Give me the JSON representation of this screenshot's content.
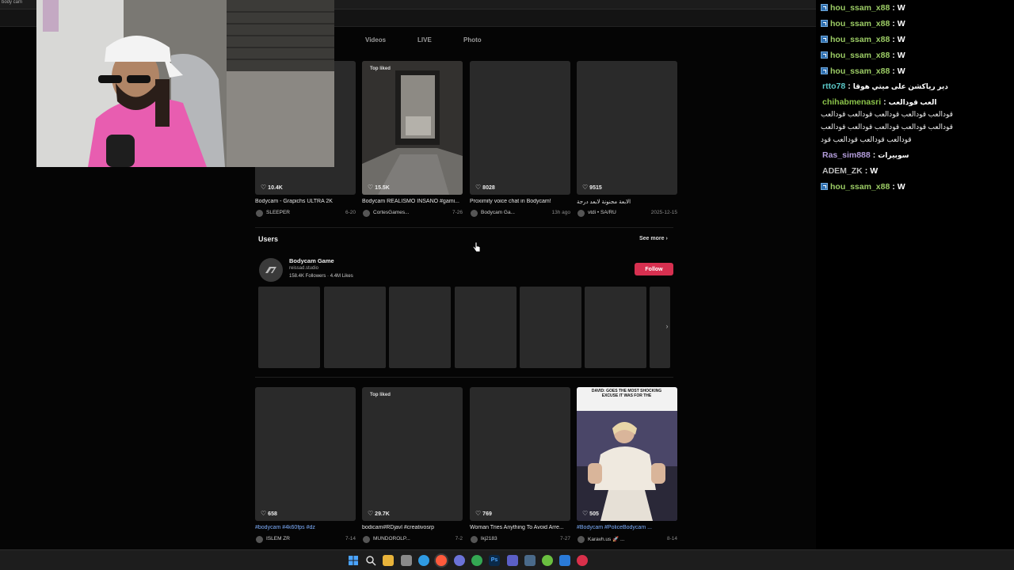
{
  "window": {
    "tab_title": "body cam"
  },
  "search": {
    "tabs": [
      "Videos",
      "LIVE",
      "Photo"
    ]
  },
  "top_videos": [
    {
      "likes": "10.4K",
      "caption": "Bodycam - Grapichs ULTRA 2K",
      "author": "SLEEPER",
      "date": "6-20",
      "badge": ""
    },
    {
      "likes": "15.5K",
      "caption": "Bodycam REALISMO INSANO #gami...",
      "author": "CortesGames...",
      "date": "7-26",
      "badge": "Top liked"
    },
    {
      "likes": "8028",
      "caption": "Proximity voice chat in Bodycam!",
      "author": "Bodycam Ga...",
      "date": "13h ago",
      "badge": ""
    },
    {
      "likes": "9515",
      "caption": "الابعة مجنونة لابعد درجة",
      "author": "vtdi • SA/RU",
      "date": "2025-12-15",
      "badge": ""
    }
  ],
  "users_section": {
    "title": "Users",
    "see_more": "See more",
    "user": {
      "name": "Bodycam Game",
      "handle": "reissad.studio",
      "followers": "158.4K Followers",
      "likes": "4.4M Likes",
      "follow_label": "Follow"
    },
    "thumb_count": 7
  },
  "bottom_videos": [
    {
      "likes": "658",
      "caption": "#bodycam #4k60fps #dz",
      "author": "ISLEM ZR",
      "date": "7-14",
      "badge": "",
      "tag": true
    },
    {
      "likes": "29.7K",
      "caption": "bodicam#RDjavl #creativosrp",
      "author": "MUNDOROLP...",
      "date": "7-2",
      "badge": "Top liked",
      "tag": false
    },
    {
      "likes": "769",
      "caption": "Woman Tries Anything To Avoid Arre...",
      "author": "lkj2183",
      "date": "7-27",
      "badge": "",
      "tag": false
    },
    {
      "likes": "505",
      "caption": "#Bodycam #PoliceBodycam ...",
      "author": "Karavh.us 🚀 ...",
      "date": "8-14",
      "badge": "",
      "tag": true,
      "overlay_text": "DAVID: GOES THE MOST SHOCKING EXCUSE IT WAS FOR THE"
    }
  ],
  "chat": {
    "messages": [
      {
        "user": "hou_ssam_x88",
        "text": "W",
        "color": "#9ccc65",
        "badge": true
      },
      {
        "user": "hou_ssam_x88",
        "text": "W",
        "color": "#9ccc65",
        "badge": true
      },
      {
        "user": "hou_ssam_x88",
        "text": "W",
        "color": "#9ccc65",
        "badge": true
      },
      {
        "user": "hou_ssam_x88",
        "text": "W",
        "color": "#9ccc65",
        "badge": true
      },
      {
        "user": "hou_ssam_x88",
        "text": "W",
        "color": "#9ccc65",
        "badge": true
      },
      {
        "user": "rtto78",
        "text": "دير رياكشن على ميتي هوقا",
        "color": "#5ac8c8",
        "badge": false
      },
      {
        "user": "chihabmenasri",
        "text": "العب قودالعب",
        "color": "#8bc34a",
        "badge": false
      },
      {
        "user": "Ras_sim888",
        "text": "سوبيرات",
        "color": "#b39ddb",
        "badge": false
      },
      {
        "user": "ADEM_ZK",
        "text": "W",
        "color": "#bdbdbd",
        "badge": false
      },
      {
        "user": "hou_ssam_x88",
        "text": "W",
        "color": "#9ccc65",
        "badge": true
      }
    ],
    "multiline_text": "قودالعب قودالعب قودالعب قودالعب قودالعب قودالعب قودالعب قودالعب قودالعب قودالعب قودالعب قودالعب قودالعب قود"
  }
}
